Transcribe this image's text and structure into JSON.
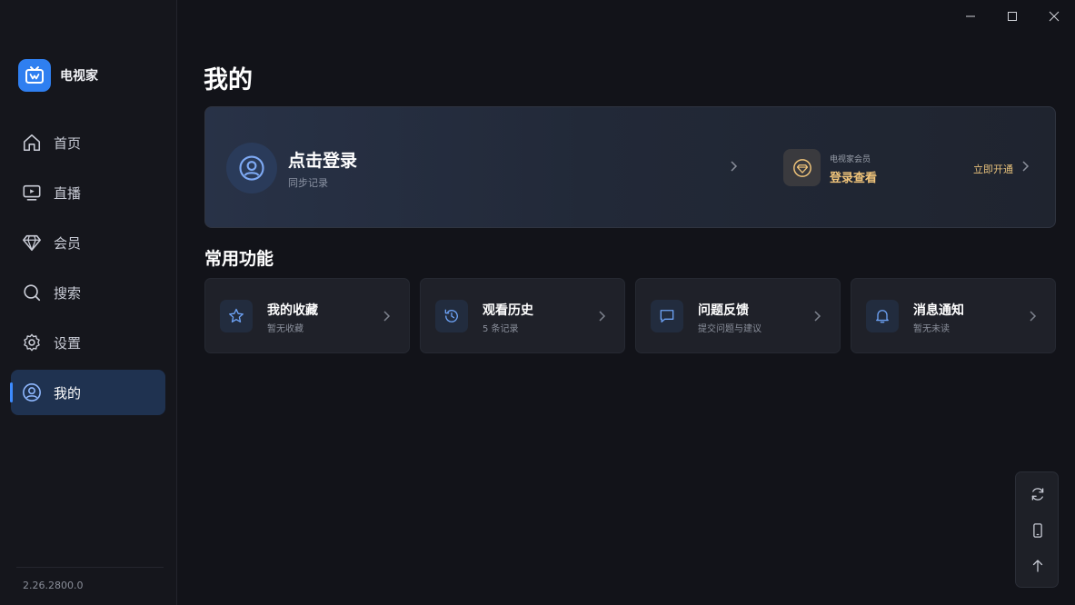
{
  "app": {
    "name": "电视家",
    "version": "2.26.2800.0"
  },
  "sidebar": {
    "items": [
      {
        "label": "首页",
        "icon": "home-icon"
      },
      {
        "label": "直播",
        "icon": "tv-play-icon"
      },
      {
        "label": "会员",
        "icon": "diamond-icon"
      },
      {
        "label": "搜索",
        "icon": "search-icon"
      },
      {
        "label": "设置",
        "icon": "gear-icon"
      },
      {
        "label": "我的",
        "icon": "user-icon",
        "active": true
      }
    ]
  },
  "page": {
    "title": "我的"
  },
  "user_card": {
    "login_title": "点击登录",
    "login_sub": "同步记录",
    "vip_small": "电视家会员",
    "vip_big": "登录查看",
    "vip_action": "立即开通"
  },
  "section": {
    "title": "常用功能"
  },
  "functions": [
    {
      "title": "我的收藏",
      "sub": "暂无收藏",
      "icon": "star-icon"
    },
    {
      "title": "观看历史",
      "sub": "5 条记录",
      "icon": "history-icon"
    },
    {
      "title": "问题反馈",
      "sub": "提交问题与建议",
      "icon": "message-icon"
    },
    {
      "title": "消息通知",
      "sub": "暂无未读",
      "icon": "bell-icon"
    }
  ],
  "float_bar": {
    "icons": [
      "refresh-icon",
      "phone-icon",
      "arrow-up-icon"
    ]
  },
  "colors": {
    "accent": "#3d8bff",
    "vip_gold": "#f0c47a",
    "background": "#121319"
  }
}
